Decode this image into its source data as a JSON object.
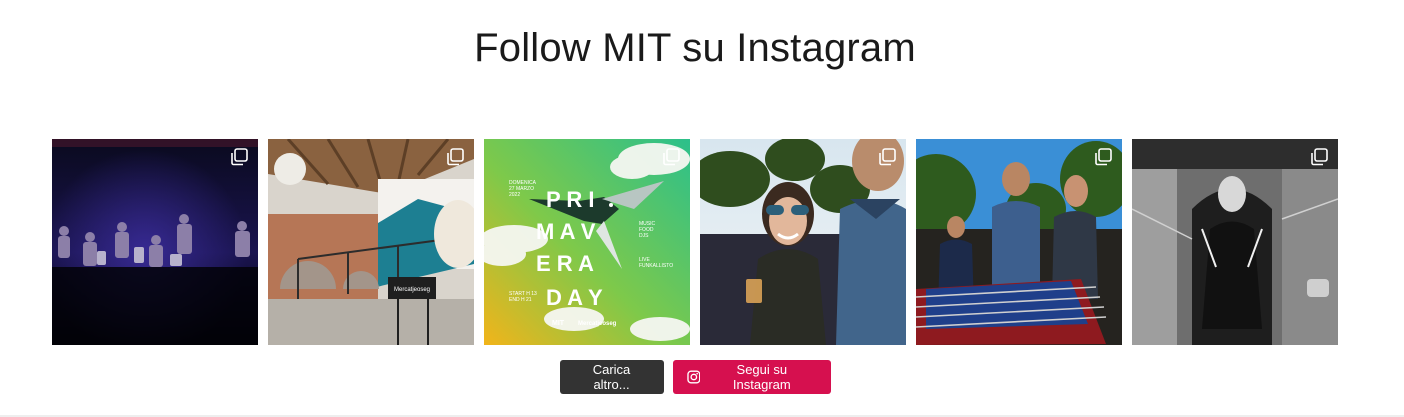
{
  "header": {
    "title": "Follow MIT su Instagram"
  },
  "feed": {
    "posts": [
      {
        "icon": "carousel-icon",
        "subject": "band-on-stage"
      },
      {
        "icon": "carousel-icon",
        "subject": "venue-interior"
      },
      {
        "icon": "carousel-icon",
        "subject": "event-poster",
        "poster": {
          "date_line1": "DOMENICA",
          "date_line2": "27 MARZO",
          "date_line3": "2022",
          "row1": "P R I",
          "row2": "M A V",
          "row3": "E R A",
          "row4": "D A Y",
          "side1_line1": "MUSIC",
          "side1_line2": "FOOD",
          "side1_line3": "DJS",
          "side2_line1": "LIVE",
          "side2_line2": "FUNKALLISTO",
          "time_line1": "START H 13",
          "time_line2": "END H 21",
          "logo1": "MIT",
          "logo2": "Mercatjeoseg"
        }
      },
      {
        "icon": "carousel-icon",
        "subject": "people-smiling"
      },
      {
        "icon": "carousel-icon",
        "subject": "table-football"
      },
      {
        "icon": "carousel-icon",
        "subject": "musician-bw"
      }
    ]
  },
  "actions": {
    "load_more_label": "Carica altro...",
    "follow_label": "Segui su Instagram"
  },
  "colors": {
    "follow_button": "#d6104f",
    "load_button": "#333333"
  }
}
